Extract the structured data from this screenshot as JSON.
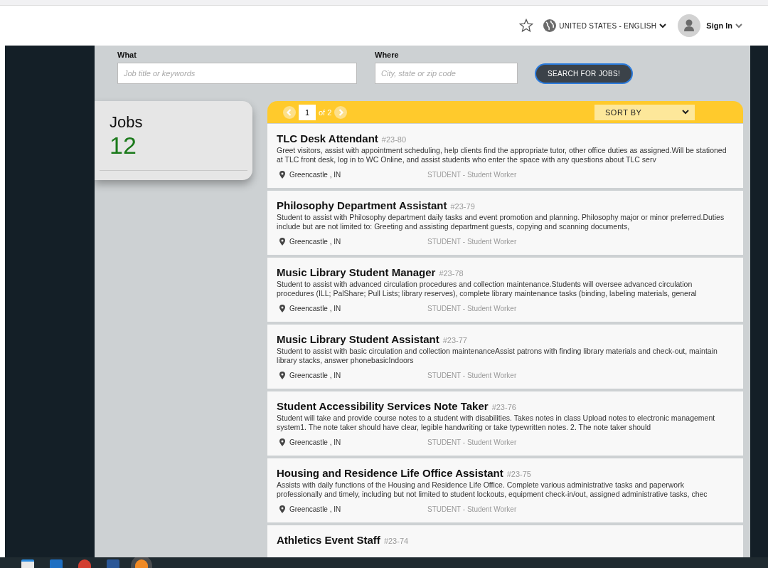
{
  "header": {
    "locale": "UNITED STATES - ENGLISH",
    "sign_in": "Sign In"
  },
  "search": {
    "what_label": "What",
    "what_placeholder": "Job title or keywords",
    "where_label": "Where",
    "where_placeholder": "City, state or zip code",
    "button": "SEARCH FOR JOBS!"
  },
  "summary": {
    "title": "Jobs",
    "count": "12"
  },
  "pagination": {
    "page": "1",
    "of": "of 2"
  },
  "sort": {
    "label": "SORT BY"
  },
  "jobs": [
    {
      "title": "TLC Desk Attendant",
      "code": "#23-80",
      "description": "Greet visitors, assist with appointment scheduling, help clients find the appropriate tutor, other office duties as assigned.Will be stationed at TLC front desk, log in to WC Online, and assist students who enter the space with any questions about TLC serv",
      "location": "Greencastle , IN",
      "type": "STUDENT - Student Worker"
    },
    {
      "title": "Philosophy Department Assistant",
      "code": "#23-79",
      "description": "Student to assist with Philosophy department daily tasks and event promotion and planning. Philosophy major or minor preferred.Duties include but are not limited to: Greeting and assisting department guests, copying and scanning documents,",
      "location": "Greencastle , IN",
      "type": "STUDENT - Student Worker"
    },
    {
      "title": "Music Library Student Manager",
      "code": "#23-78",
      "description": "Student to assist with advanced circulation procedures and collection maintenance.Students will oversee advanced circulation procedures (ILL; PalShare; Pull Lists; library reserves), complete library maintenance tasks (binding, labeling materials, general",
      "location": "Greencastle , IN",
      "type": "STUDENT - Student Worker"
    },
    {
      "title": "Music Library Student Assistant",
      "code": "#23-77",
      "description": "Student to assist with basic circulation and collection maintenanceAssist patrons with finding library materials and check-out, maintain library stacks, answer phonebasicIndoors",
      "location": "Greencastle , IN",
      "type": "STUDENT - Student Worker"
    },
    {
      "title": "Student Accessibility Services Note Taker",
      "code": "#23-76",
      "description": "Student will take and provide course notes to a student with disabilities. Takes notes in class Upload notes to electronic management system1. The note taker should have clear, legible handwriting or take typewritten notes. 2. The note taker should",
      "location": "Greencastle , IN",
      "type": "STUDENT - Student Worker"
    },
    {
      "title": "Housing and Residence Life Office Assistant",
      "code": "#23-75",
      "description": "Assists with daily functions of the Housing and Residence Life Office. Complete various administrative tasks and paperwork professionally and timely, including but not limited to student lockouts, equipment check-in/out, assigned administrative tasks, chec",
      "location": "Greencastle , IN",
      "type": "STUDENT - Student Worker"
    },
    {
      "title": "Athletics Event Staff",
      "code": "#23-74"
    }
  ]
}
